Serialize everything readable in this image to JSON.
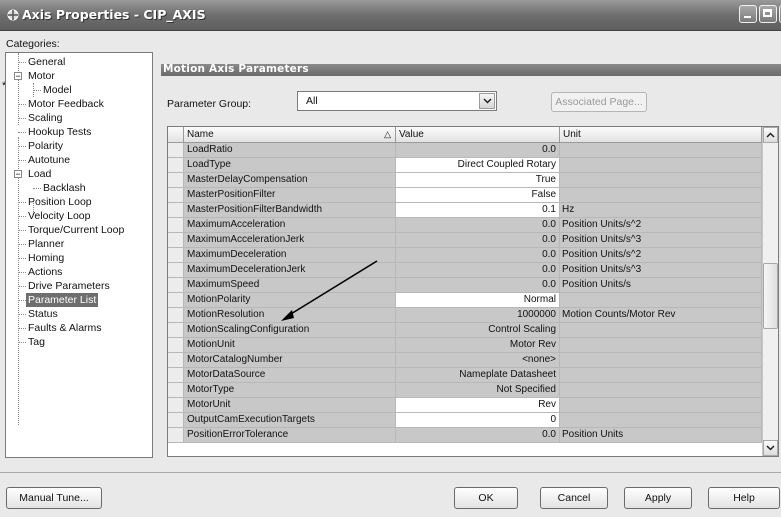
{
  "window": {
    "title": "Axis Properties - CIP_AXIS"
  },
  "categories": {
    "label": "Categories:",
    "items": [
      {
        "label": "General",
        "level": 0
      },
      {
        "label": "Motor",
        "level": 0,
        "expanded": true
      },
      {
        "label": "Model",
        "level": 1
      },
      {
        "label": "Motor Feedback",
        "level": 0
      },
      {
        "label": "Scaling",
        "level": 0,
        "modified": true
      },
      {
        "label": "Hookup Tests",
        "level": 0
      },
      {
        "label": "Polarity",
        "level": 0
      },
      {
        "label": "Autotune",
        "level": 0
      },
      {
        "label": "Load",
        "level": 0,
        "expanded": true
      },
      {
        "label": "Backlash",
        "level": 1
      },
      {
        "label": "Position Loop",
        "level": 0
      },
      {
        "label": "Velocity Loop",
        "level": 0
      },
      {
        "label": "Torque/Current Loop",
        "level": 0
      },
      {
        "label": "Planner",
        "level": 0
      },
      {
        "label": "Homing",
        "level": 0
      },
      {
        "label": "Actions",
        "level": 0
      },
      {
        "label": "Drive Parameters",
        "level": 0
      },
      {
        "label": "Parameter List",
        "level": 0,
        "selected": true
      },
      {
        "label": "Status",
        "level": 0
      },
      {
        "label": "Faults & Alarms",
        "level": 0
      },
      {
        "label": "Tag",
        "level": 0
      }
    ],
    "modified_marker": "*",
    "collapse_glyph": "−"
  },
  "panel": {
    "title": "Motion Axis Parameters",
    "parameter_group_label": "Parameter Group:",
    "parameter_group_value": "All",
    "associated_page_label": "Associated Page..."
  },
  "grid": {
    "columns": {
      "name": "Name",
      "value": "Value",
      "unit": "Unit"
    },
    "sort_glyph": "△",
    "rows": [
      {
        "name": "LoadRatio",
        "value": "0.0",
        "unit": "",
        "editable": false
      },
      {
        "name": "LoadType",
        "value": "Direct Coupled Rotary",
        "unit": "",
        "editable": true
      },
      {
        "name": "MasterDelayCompensation",
        "value": "True",
        "unit": "",
        "editable": true
      },
      {
        "name": "MasterPositionFilter",
        "value": "False",
        "unit": "",
        "editable": true
      },
      {
        "name": "MasterPositionFilterBandwidth",
        "value": "0.1",
        "unit": "Hz",
        "editable": true
      },
      {
        "name": "MaximumAcceleration",
        "value": "0.0",
        "unit": "Position Units/s^2",
        "editable": false
      },
      {
        "name": "MaximumAccelerationJerk",
        "value": "0.0",
        "unit": "Position Units/s^3",
        "editable": false
      },
      {
        "name": "MaximumDeceleration",
        "value": "0.0",
        "unit": "Position Units/s^2",
        "editable": false
      },
      {
        "name": "MaximumDecelerationJerk",
        "value": "0.0",
        "unit": "Position Units/s^3",
        "editable": false
      },
      {
        "name": "MaximumSpeed",
        "value": "0.0",
        "unit": "Position Units/s",
        "editable": false
      },
      {
        "name": "MotionPolarity",
        "value": "Normal",
        "unit": "",
        "editable": true
      },
      {
        "name": "MotionResolution",
        "value": "1000000",
        "unit": "Motion Counts/Motor Rev",
        "editable": false
      },
      {
        "name": "MotionScalingConfiguration",
        "value": "Control Scaling",
        "unit": "",
        "editable": false
      },
      {
        "name": "MotionUnit",
        "value": "Motor Rev",
        "unit": "",
        "editable": false
      },
      {
        "name": "MotorCatalogNumber",
        "value": "<none>",
        "unit": "",
        "editable": false
      },
      {
        "name": "MotorDataSource",
        "value": "Nameplate Datasheet",
        "unit": "",
        "editable": false
      },
      {
        "name": "MotorType",
        "value": "Not Specified",
        "unit": "",
        "editable": false
      },
      {
        "name": "MotorUnit",
        "value": "Rev",
        "unit": "",
        "editable": true
      },
      {
        "name": "OutputCamExecutionTargets",
        "value": "0",
        "unit": "",
        "editable": true
      },
      {
        "name": "PositionErrorTolerance",
        "value": "0.0",
        "unit": "Position Units",
        "editable": false
      }
    ]
  },
  "buttons": {
    "manual_tune": "Manual Tune...",
    "ok": "OK",
    "cancel": "Cancel",
    "apply": "Apply",
    "help": "Help"
  },
  "icons": {
    "dropdown": "chevron-down-icon",
    "scroll_up": "scroll-up-icon",
    "scroll_down": "scroll-down-icon"
  }
}
